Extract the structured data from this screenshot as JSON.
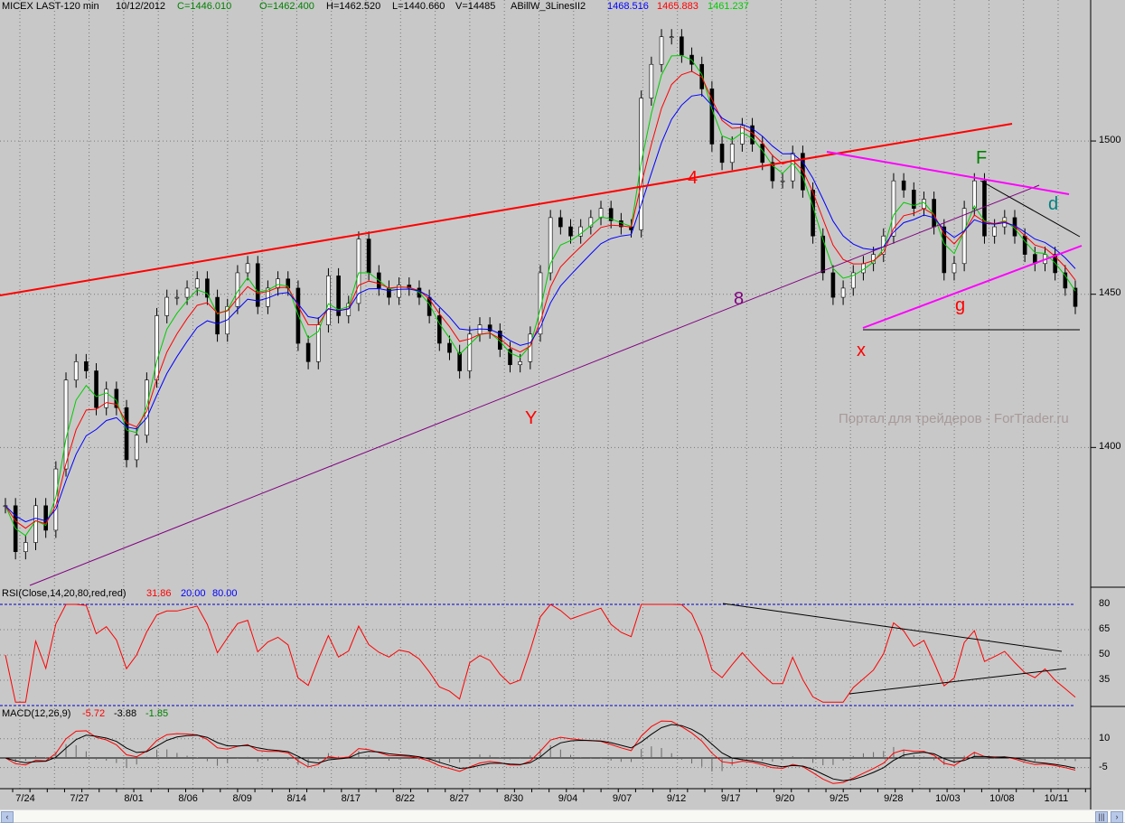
{
  "header": {
    "symbol": "MICEX LAST-120 min",
    "date": "10/12/2012",
    "close": "C=1446.010",
    "open": "O=1462.400",
    "high": "H=1462.520",
    "low": "L=1440.660",
    "volume": "V=14485",
    "indicator": "ABillW_3LinesII2",
    "line_blue": "1468.516",
    "line_red": "1465.883",
    "line_green": "1461.237"
  },
  "rsi_header": {
    "label": "RSI(Close,14,20,80,red,red)",
    "value": "31.86",
    "low": "20.00",
    "high": "80.00"
  },
  "macd_header": {
    "label": "MACD(12,26,9)",
    "macd": "-5.72",
    "signal": "-3.88",
    "hist": "-1.85"
  },
  "watermark": "Портал для трейдеров - ForTrader.ru",
  "annotations": {
    "four": "4",
    "eight": "8",
    "Y": "Y",
    "x": "x",
    "g": "g",
    "F": "F",
    "d": "d"
  },
  "colors": {
    "bg": "#c8c8c8",
    "fast": "#00cc00",
    "mid": "#ff0000",
    "slow": "#0000ff",
    "rsi": "#ff0000",
    "trend_red": "#ff0000",
    "trend_purple": "#800080",
    "trend_magenta": "#ff00ff"
  },
  "chart_data": {
    "type": "candlestick",
    "title": "MICEX LAST-120 min",
    "price_axis": {
      "ylim": [
        1355,
        1546
      ],
      "ticks": [
        "1500",
        "1450",
        "1400"
      ]
    },
    "rsi_axis": {
      "ylim": [
        20,
        80
      ],
      "ticks": [
        "80",
        "65",
        "50",
        "35"
      ]
    },
    "macd_axis": {
      "ticks": [
        "10",
        "-5"
      ]
    },
    "x_ticks": [
      "7/24",
      "7/27",
      "8/01",
      "8/06",
      "8/09",
      "8/14",
      "8/17",
      "8/22",
      "8/27",
      "8/30",
      "9/04",
      "9/07",
      "9/12",
      "9/17",
      "9/20",
      "9/25",
      "9/28",
      "10/03",
      "10/08",
      "10/11"
    ],
    "closes": [
      1381,
      1366,
      1369,
      1381,
      1373,
      1393,
      1422,
      1428,
      1425,
      1413,
      1419,
      1413,
      1396,
      1404,
      1422,
      1443,
      1449,
      1449,
      1452,
      1455,
      1449,
      1437,
      1446,
      1457,
      1460,
      1446,
      1452,
      1455,
      1452,
      1434,
      1428,
      1440,
      1456,
      1443,
      1447,
      1468,
      1457,
      1452,
      1449,
      1453,
      1452,
      1449,
      1443,
      1434,
      1431,
      1425,
      1437,
      1440,
      1438,
      1432,
      1427,
      1428,
      1437,
      1457,
      1475,
      1472,
      1469,
      1472,
      1475,
      1478,
      1474,
      1472,
      1471,
      1514,
      1525,
      1534,
      1534,
      1528,
      1525,
      1517,
      1499,
      1493,
      1499,
      1505,
      1499,
      1493,
      1487,
      1487,
      1496,
      1484,
      1469,
      1457,
      1449,
      1452,
      1457,
      1460,
      1463,
      1469,
      1487,
      1484,
      1478,
      1481,
      1472,
      1457,
      1460,
      1478,
      1487,
      1469,
      1472,
      1475,
      1469,
      1463,
      1460,
      1463,
      1457,
      1452,
      1446
    ]
  }
}
